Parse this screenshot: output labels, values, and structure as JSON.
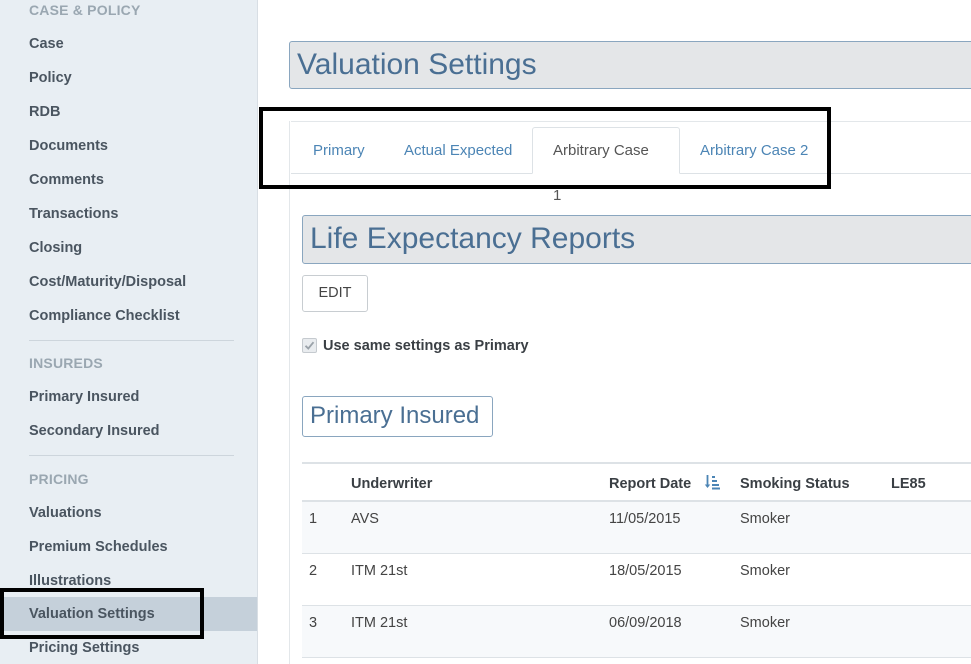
{
  "sidebar": {
    "sections": [
      {
        "heading": "CASE & POLICY",
        "items": [
          "Case",
          "Policy",
          "RDB",
          "Documents",
          "Comments",
          "Transactions",
          "Closing",
          "Cost/Maturity/Disposal",
          "Compliance Checklist"
        ]
      },
      {
        "heading": "INSUREDS",
        "items": [
          "Primary Insured",
          "Secondary Insured"
        ]
      },
      {
        "heading": "PRICING",
        "items": [
          "Valuations",
          "Premium Schedules",
          "Illustrations",
          "Valuation Settings",
          "Pricing Settings"
        ]
      }
    ],
    "active_item": "Valuation Settings"
  },
  "page": {
    "title": "Valuation Settings"
  },
  "tabs": [
    "Primary",
    "Actual Expected",
    "Arbitrary Case 1",
    "Arbitrary Case 2"
  ],
  "active_tab": "Arbitrary Case 1",
  "life_expectancy": {
    "title": "Life Expectancy Reports",
    "edit_label": "EDIT",
    "use_same_label": "Use same settings as Primary",
    "use_same_checked": true,
    "insured_heading": "Primary Insured"
  },
  "table": {
    "headers": [
      "",
      "Underwriter",
      "Report Date",
      "Smoking Status",
      "LE85"
    ],
    "rows": [
      [
        "1",
        "AVS",
        "11/05/2015",
        "Smoker",
        ""
      ],
      [
        "2",
        "ITM 21st",
        "18/05/2015",
        "Smoker",
        ""
      ],
      [
        "3",
        "ITM 21st",
        "06/09/2018",
        "Smoker",
        ""
      ]
    ]
  },
  "colors": {
    "accent": "#4a6f93",
    "link": "#4c85b5",
    "sidebar_bg": "#e8eef3",
    "active_bg": "#c5d0da"
  }
}
